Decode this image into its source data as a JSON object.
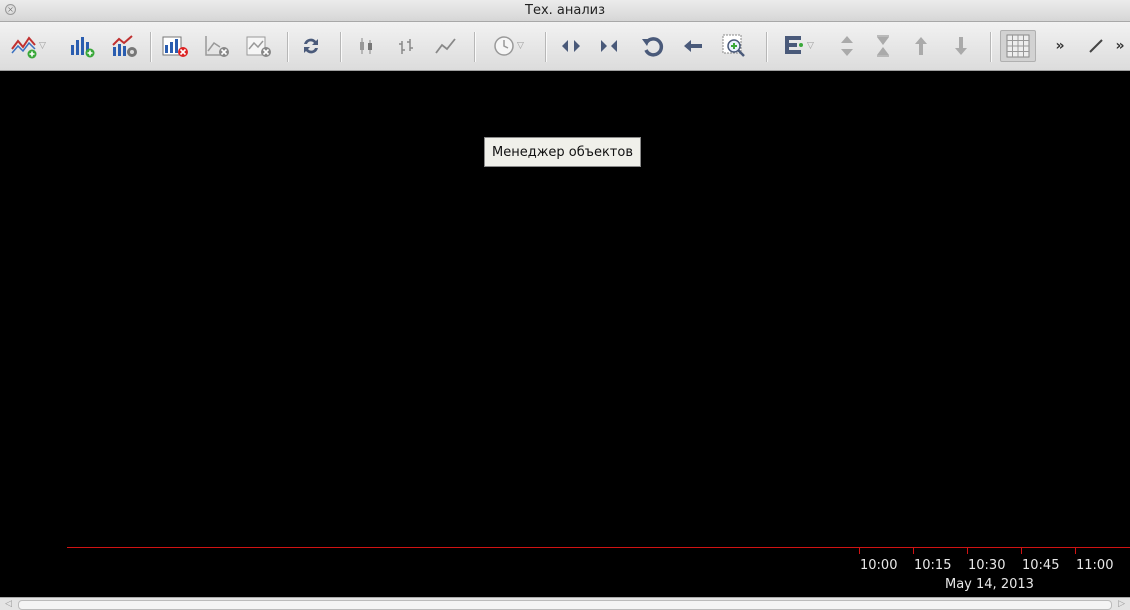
{
  "window": {
    "title": "Тех. анализ"
  },
  "toolbar": {
    "overflow_label_1": "»",
    "overflow_label_2": "»"
  },
  "tooltip": {
    "text": "Менеджер объектов"
  },
  "time_axis": {
    "ticks": [
      "10:00",
      "10:15",
      "10:30",
      "10:45",
      "11:00"
    ],
    "date": "May 14, 2013"
  },
  "colors": {
    "axis": "#d11313",
    "background": "#000000",
    "toolbar": "#e6e6e6"
  }
}
